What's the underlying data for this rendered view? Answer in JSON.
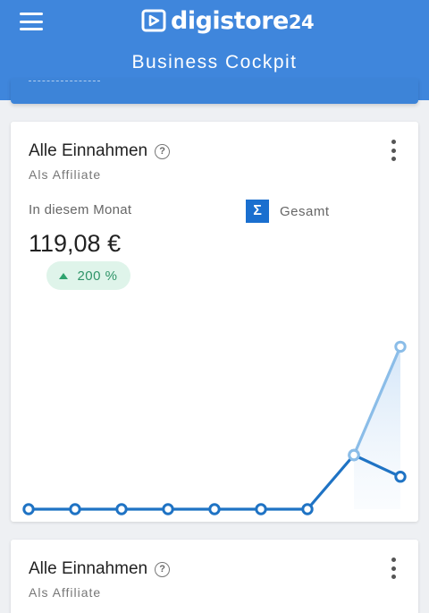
{
  "header": {
    "brand": "digistore",
    "brand_suffix": "24",
    "title": "Business Cockpit"
  },
  "cards": [
    {
      "title": "Alle Einnahmen",
      "subtitle": "Als Affiliate",
      "period": "In diesem Monat",
      "total_label": "Gesamt",
      "total_symbol": "Σ",
      "amount": "119,08 €",
      "change": "200 %"
    },
    {
      "title": "Alle Einnahmen",
      "subtitle": "Als Affiliate"
    }
  ],
  "chart_data": {
    "type": "line",
    "x": [
      1,
      2,
      3,
      4,
      5,
      6,
      7,
      8,
      9
    ],
    "ylim": [
      0,
      180
    ],
    "series": [
      {
        "values": [
          0,
          0,
          0,
          0,
          0,
          0,
          0,
          59.5,
          35.7
        ],
        "color": "#1f73c4"
      },
      {
        "values": [
          null,
          null,
          null,
          null,
          null,
          null,
          null,
          59.5,
          178.6
        ],
        "color": "#8bbde8"
      }
    ]
  },
  "colors": {
    "header": "#3f86dc",
    "accent": "#1a6fcf",
    "positive": "#2f9468"
  }
}
